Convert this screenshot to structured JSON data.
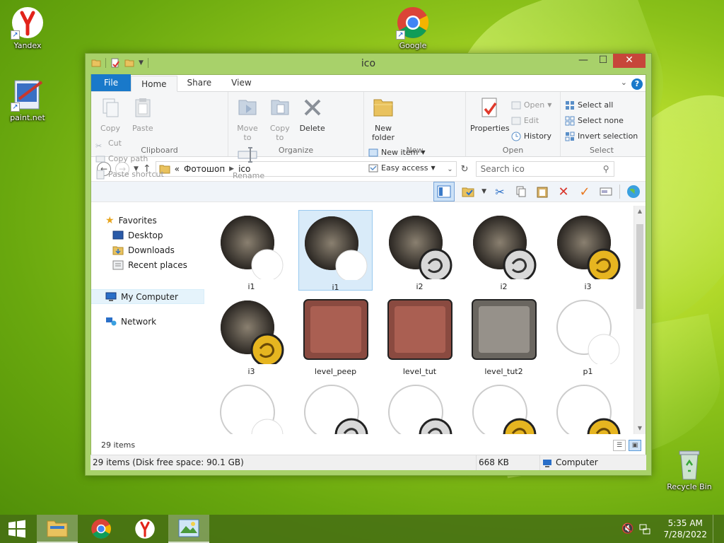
{
  "desktop": {
    "icons": [
      {
        "label": "Yandex"
      },
      {
        "label": "Google"
      },
      {
        "label": "paint.net"
      },
      {
        "label": "Recycle Bin"
      }
    ]
  },
  "window": {
    "title": "ico",
    "tabs": {
      "file": "File",
      "home": "Home",
      "share": "Share",
      "view": "View"
    },
    "help": "?",
    "close": "✕",
    "minimize": "—",
    "maximize": "☐"
  },
  "ribbon": {
    "clipboard": {
      "label": "Clipboard",
      "copy": "Copy",
      "paste": "Paste",
      "cut": "Cut",
      "copy_path": "Copy path",
      "paste_shortcut": "Paste shortcut"
    },
    "organize": {
      "label": "Organize",
      "move_to": "Move to",
      "copy_to": "Copy to",
      "delete": "Delete",
      "rename": "Rename"
    },
    "new": {
      "label": "New",
      "new_folder": "New folder",
      "new_item": "New item",
      "easy_access": "Easy access"
    },
    "open": {
      "label": "Open",
      "properties": "Properties",
      "open": "Open",
      "edit": "Edit",
      "history": "History"
    },
    "select": {
      "label": "Select",
      "select_all": "Select all",
      "select_none": "Select none",
      "invert": "Invert selection"
    }
  },
  "address": {
    "prefix": "«",
    "crumbs": [
      "Фотошоп",
      "ico"
    ],
    "search_placeholder": "Search ico"
  },
  "navpane": {
    "favorites": "Favorites",
    "desktop": "Desktop",
    "downloads": "Downloads",
    "recent": "Recent places",
    "computer": "My Computer",
    "network": "Network"
  },
  "files": [
    {
      "name": "i1",
      "kind": "photo-white",
      "selected": false
    },
    {
      "name": "i1",
      "kind": "photo-white",
      "selected": true
    },
    {
      "name": "i2",
      "kind": "photo-silver",
      "selected": false
    },
    {
      "name": "i2",
      "kind": "photo-silver",
      "selected": false
    },
    {
      "name": "i3",
      "kind": "photo-gold",
      "selected": false
    },
    {
      "name": "i3",
      "kind": "photo-gold",
      "selected": false
    },
    {
      "name": "level_peep",
      "kind": "level-red",
      "selected": false
    },
    {
      "name": "level_tut",
      "kind": "level-red",
      "selected": false
    },
    {
      "name": "level_tut2",
      "kind": "level-gray",
      "selected": false
    },
    {
      "name": "p1",
      "kind": "plain-white",
      "selected": false
    },
    {
      "name": "",
      "kind": "plain-white",
      "selected": false
    },
    {
      "name": "",
      "kind": "plain-silver",
      "selected": false
    },
    {
      "name": "",
      "kind": "plain-silver",
      "selected": false
    },
    {
      "name": "",
      "kind": "plain-gold",
      "selected": false
    },
    {
      "name": "",
      "kind": "plain-gold",
      "selected": false
    }
  ],
  "item_count": "29 items",
  "status": {
    "left": "29 items (Disk free space: 90.1 GB)",
    "size": "668 KB",
    "location": "Computer"
  },
  "tray": {
    "time": "5:35 AM",
    "date": "7/28/2022"
  },
  "colors": {
    "accent": "#1979ca",
    "window_frame": "#a8d16a",
    "close": "#c7463a"
  }
}
